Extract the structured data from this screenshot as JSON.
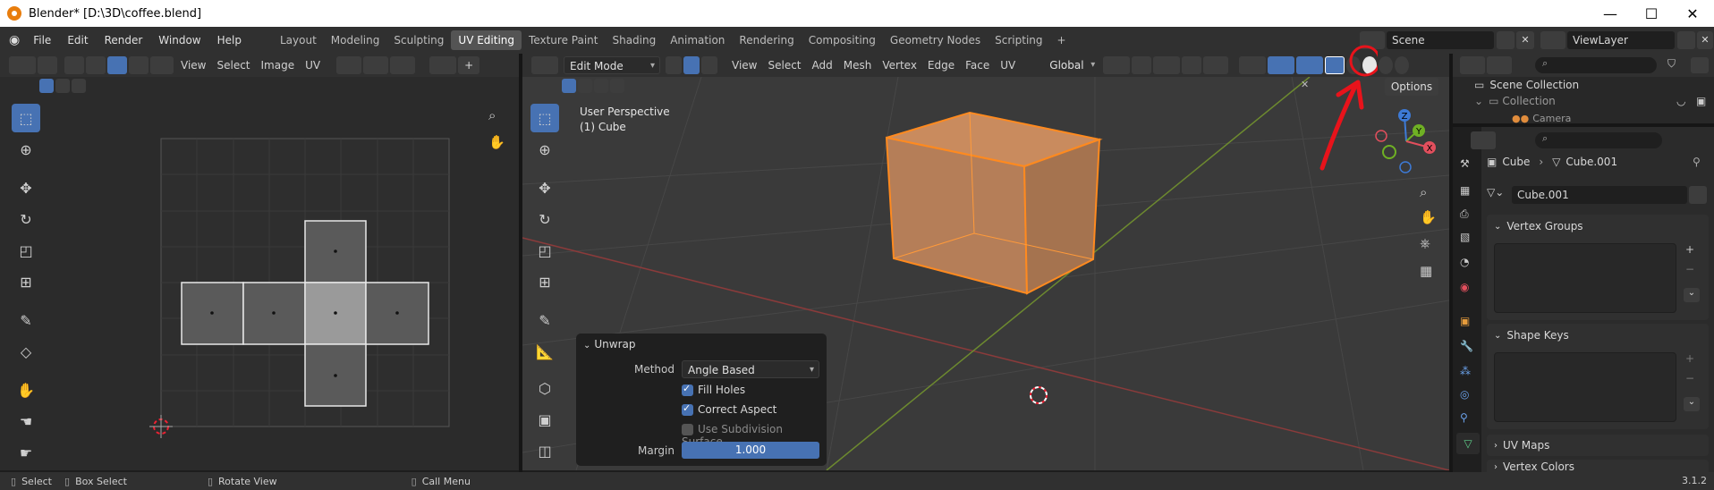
{
  "window": {
    "title": "Blender* [D:\\3D\\coffee.blend]",
    "minimize": "—",
    "maximize": "☐",
    "close": "✕"
  },
  "menubar": {
    "menus": [
      "File",
      "Edit",
      "Render",
      "Window",
      "Help"
    ],
    "workspaces": [
      "Layout",
      "Modeling",
      "Sculpting",
      "UV Editing",
      "Texture Paint",
      "Shading",
      "Animation",
      "Rendering",
      "Compositing",
      "Geometry Nodes",
      "Scripting"
    ],
    "active_workspace": "UV Editing",
    "add_workspace": "+",
    "scene": "Scene",
    "view_layer": "ViewLayer"
  },
  "uv_editor": {
    "menus": [
      "View",
      "Select",
      "Image",
      "UV"
    ]
  },
  "viewport": {
    "mode": "Edit Mode",
    "menus": [
      "View",
      "Select",
      "Add",
      "Mesh",
      "Vertex",
      "Edge",
      "Face",
      "UV"
    ],
    "transform_orientation": "Global",
    "options": "Options",
    "perspective_label": "User Perspective",
    "object_label": "(1) Cube",
    "axis_labels": [
      "Z",
      "Y",
      "X"
    ]
  },
  "unwrap_panel": {
    "title": "Unwrap",
    "method_label": "Method",
    "method_value": "Angle Based",
    "fill_holes": "Fill Holes",
    "correct_aspect": "Correct Aspect",
    "use_subdivision": "Use Subdivision Surface",
    "margin_label": "Margin",
    "margin_value": "1.000",
    "fill_holes_checked": true,
    "correct_aspect_checked": true,
    "use_subdivision_checked": false
  },
  "outliner": {
    "root": "Scene Collection",
    "collection": "Collection",
    "camera": "Camera"
  },
  "properties": {
    "breadcrumb_object": "Cube",
    "breadcrumb_mesh": "Cube.001",
    "mesh_name": "Cube.001",
    "panels": [
      "Vertex Groups",
      "Shape Keys",
      "UV Maps",
      "Vertex Colors"
    ]
  },
  "statusbar": {
    "select": "Select",
    "box_select": "Box Select",
    "rotate_view": "Rotate View",
    "call_menu": "Call Menu",
    "version": "3.1.2"
  },
  "colors": {
    "accent": "#4772b3",
    "selection_orange": "#ff8a1f",
    "annotation_red": "#e8131b"
  }
}
